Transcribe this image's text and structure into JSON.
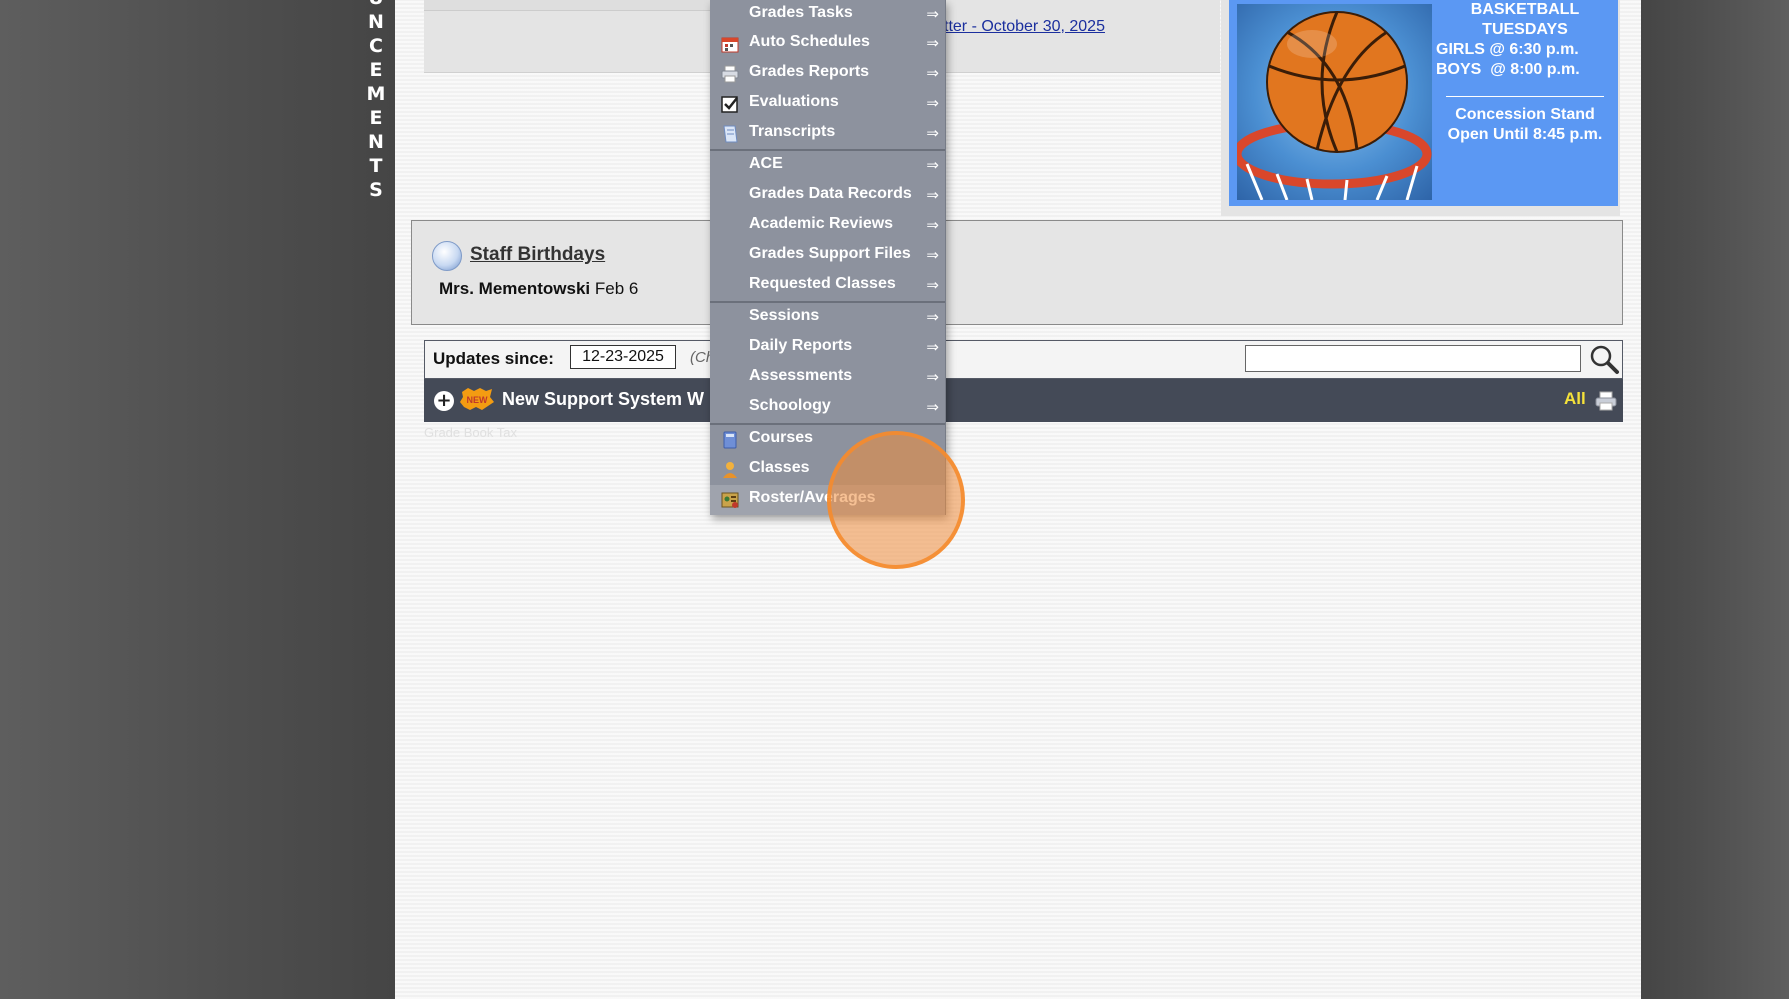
{
  "sidebar": {
    "vertical_title_letters": [
      "U",
      "N",
      "C",
      "E",
      "M",
      "E",
      "N",
      "T",
      "S"
    ]
  },
  "news": {
    "link_text": "tter - October 30, 2025"
  },
  "ad": {
    "line1": "BASKETBALL",
    "line2": "TUESDAYS",
    "line3": "GIRLS @ 6:30 p.m.",
    "line4": "BOYS  @ 8:00 p.m.",
    "line5": "Concession Stand",
    "line6": "Open Until 8:45 p.m.",
    "colors": {
      "background": "#5b98f3",
      "text": "#ffffff"
    }
  },
  "birthdays": {
    "title": "Staff Birthdays",
    "entries": [
      {
        "name": "Mrs. Mementowski",
        "date": "Feb 6"
      }
    ]
  },
  "updates": {
    "label": "Updates since:",
    "date_value": "12-23-2025",
    "hint": "(Ch",
    "search_placeholder": "",
    "row_badge": "NEW",
    "row_title": "New Support System W",
    "all_label": "All",
    "faded_text": "Grade Book Tax"
  },
  "menu": {
    "arrow_glyph": "⇒",
    "items": [
      {
        "label": "Grades Tasks",
        "icon": "none"
      },
      {
        "label": "Auto Schedules",
        "icon": "calendar-icon"
      },
      {
        "label": "Grades Reports",
        "icon": "printer-icon"
      },
      {
        "label": "Evaluations",
        "icon": "checkbox-icon"
      },
      {
        "label": "Transcripts",
        "icon": "document-icon"
      },
      {
        "label": "ACE",
        "icon": "none"
      },
      {
        "label": "Grades Data Records",
        "icon": "none"
      },
      {
        "label": "Academic Reviews",
        "icon": "none"
      },
      {
        "label": "Grades Support Files",
        "icon": "none"
      },
      {
        "label": "Requested Classes",
        "icon": "none"
      },
      {
        "label": "Sessions",
        "icon": "none"
      },
      {
        "label": "Daily Reports",
        "icon": "none"
      },
      {
        "label": "Assessments",
        "icon": "none"
      },
      {
        "label": "Schoology",
        "icon": "none"
      },
      {
        "label": "Courses",
        "icon": "book-icon"
      },
      {
        "label": "Classes",
        "icon": "person-icon"
      },
      {
        "label": "Roster/Averages",
        "icon": "roster-icon"
      }
    ],
    "colors": {
      "background": "#8d929e",
      "text": "#ffffff",
      "separator": "#6b707b"
    }
  }
}
